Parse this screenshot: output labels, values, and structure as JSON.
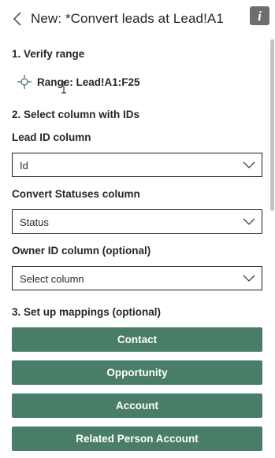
{
  "header": {
    "title": "New: *Convert leads at Lead!A1",
    "info_glyph": "i"
  },
  "sections": {
    "verify_range": "1. Verify range",
    "range_text": "Range: Lead!A1:F25",
    "select_ids": "2. Select column with IDs",
    "mappings": "3. Set up mappings (optional)"
  },
  "fields": {
    "lead_id": {
      "label": "Lead ID column",
      "value": "Id"
    },
    "convert_status": {
      "label": "Convert Statuses column",
      "value": "Status"
    },
    "owner_id": {
      "label": "Owner ID column (optional)",
      "value": "Select column"
    }
  },
  "mapping_buttons": [
    "Contact",
    "Opportunity",
    "Account",
    "Related Person Account"
  ],
  "colors": {
    "button_green": "#497d67",
    "info_gray": "#6e6e6e"
  }
}
